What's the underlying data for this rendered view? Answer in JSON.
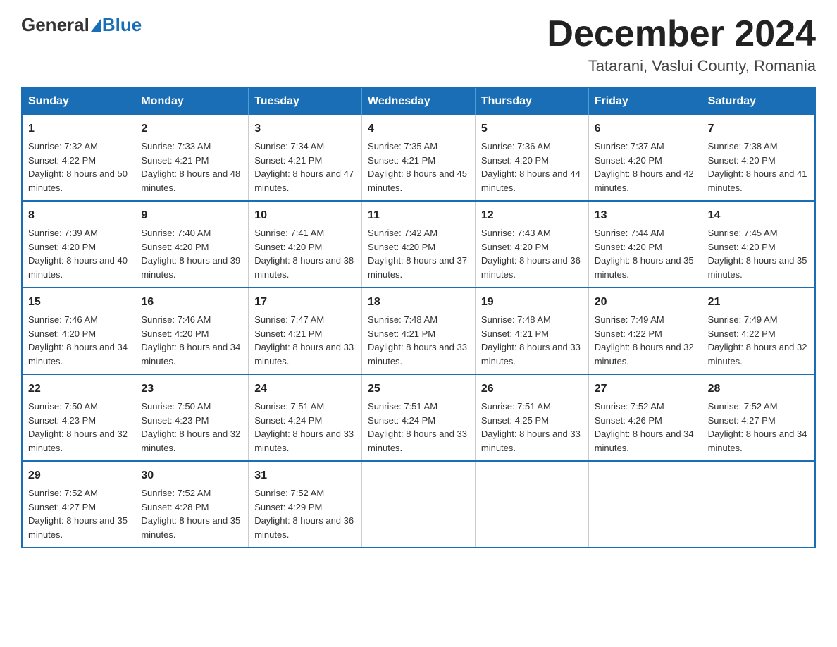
{
  "header": {
    "logo": {
      "general": "General",
      "blue": "Blue"
    },
    "title": "December 2024",
    "location": "Tatarani, Vaslui County, Romania"
  },
  "calendar": {
    "days_of_week": [
      "Sunday",
      "Monday",
      "Tuesday",
      "Wednesday",
      "Thursday",
      "Friday",
      "Saturday"
    ],
    "weeks": [
      [
        {
          "day": "1",
          "sunrise": "7:32 AM",
          "sunset": "4:22 PM",
          "daylight": "8 hours and 50 minutes."
        },
        {
          "day": "2",
          "sunrise": "7:33 AM",
          "sunset": "4:21 PM",
          "daylight": "8 hours and 48 minutes."
        },
        {
          "day": "3",
          "sunrise": "7:34 AM",
          "sunset": "4:21 PM",
          "daylight": "8 hours and 47 minutes."
        },
        {
          "day": "4",
          "sunrise": "7:35 AM",
          "sunset": "4:21 PM",
          "daylight": "8 hours and 45 minutes."
        },
        {
          "day": "5",
          "sunrise": "7:36 AM",
          "sunset": "4:20 PM",
          "daylight": "8 hours and 44 minutes."
        },
        {
          "day": "6",
          "sunrise": "7:37 AM",
          "sunset": "4:20 PM",
          "daylight": "8 hours and 42 minutes."
        },
        {
          "day": "7",
          "sunrise": "7:38 AM",
          "sunset": "4:20 PM",
          "daylight": "8 hours and 41 minutes."
        }
      ],
      [
        {
          "day": "8",
          "sunrise": "7:39 AM",
          "sunset": "4:20 PM",
          "daylight": "8 hours and 40 minutes."
        },
        {
          "day": "9",
          "sunrise": "7:40 AM",
          "sunset": "4:20 PM",
          "daylight": "8 hours and 39 minutes."
        },
        {
          "day": "10",
          "sunrise": "7:41 AM",
          "sunset": "4:20 PM",
          "daylight": "8 hours and 38 minutes."
        },
        {
          "day": "11",
          "sunrise": "7:42 AM",
          "sunset": "4:20 PM",
          "daylight": "8 hours and 37 minutes."
        },
        {
          "day": "12",
          "sunrise": "7:43 AM",
          "sunset": "4:20 PM",
          "daylight": "8 hours and 36 minutes."
        },
        {
          "day": "13",
          "sunrise": "7:44 AM",
          "sunset": "4:20 PM",
          "daylight": "8 hours and 35 minutes."
        },
        {
          "day": "14",
          "sunrise": "7:45 AM",
          "sunset": "4:20 PM",
          "daylight": "8 hours and 35 minutes."
        }
      ],
      [
        {
          "day": "15",
          "sunrise": "7:46 AM",
          "sunset": "4:20 PM",
          "daylight": "8 hours and 34 minutes."
        },
        {
          "day": "16",
          "sunrise": "7:46 AM",
          "sunset": "4:20 PM",
          "daylight": "8 hours and 34 minutes."
        },
        {
          "day": "17",
          "sunrise": "7:47 AM",
          "sunset": "4:21 PM",
          "daylight": "8 hours and 33 minutes."
        },
        {
          "day": "18",
          "sunrise": "7:48 AM",
          "sunset": "4:21 PM",
          "daylight": "8 hours and 33 minutes."
        },
        {
          "day": "19",
          "sunrise": "7:48 AM",
          "sunset": "4:21 PM",
          "daylight": "8 hours and 33 minutes."
        },
        {
          "day": "20",
          "sunrise": "7:49 AM",
          "sunset": "4:22 PM",
          "daylight": "8 hours and 32 minutes."
        },
        {
          "day": "21",
          "sunrise": "7:49 AM",
          "sunset": "4:22 PM",
          "daylight": "8 hours and 32 minutes."
        }
      ],
      [
        {
          "day": "22",
          "sunrise": "7:50 AM",
          "sunset": "4:23 PM",
          "daylight": "8 hours and 32 minutes."
        },
        {
          "day": "23",
          "sunrise": "7:50 AM",
          "sunset": "4:23 PM",
          "daylight": "8 hours and 32 minutes."
        },
        {
          "day": "24",
          "sunrise": "7:51 AM",
          "sunset": "4:24 PM",
          "daylight": "8 hours and 33 minutes."
        },
        {
          "day": "25",
          "sunrise": "7:51 AM",
          "sunset": "4:24 PM",
          "daylight": "8 hours and 33 minutes."
        },
        {
          "day": "26",
          "sunrise": "7:51 AM",
          "sunset": "4:25 PM",
          "daylight": "8 hours and 33 minutes."
        },
        {
          "day": "27",
          "sunrise": "7:52 AM",
          "sunset": "4:26 PM",
          "daylight": "8 hours and 34 minutes."
        },
        {
          "day": "28",
          "sunrise": "7:52 AM",
          "sunset": "4:27 PM",
          "daylight": "8 hours and 34 minutes."
        }
      ],
      [
        {
          "day": "29",
          "sunrise": "7:52 AM",
          "sunset": "4:27 PM",
          "daylight": "8 hours and 35 minutes."
        },
        {
          "day": "30",
          "sunrise": "7:52 AM",
          "sunset": "4:28 PM",
          "daylight": "8 hours and 35 minutes."
        },
        {
          "day": "31",
          "sunrise": "7:52 AM",
          "sunset": "4:29 PM",
          "daylight": "8 hours and 36 minutes."
        },
        null,
        null,
        null,
        null
      ]
    ],
    "labels": {
      "sunrise": "Sunrise:",
      "sunset": "Sunset:",
      "daylight": "Daylight:"
    }
  }
}
